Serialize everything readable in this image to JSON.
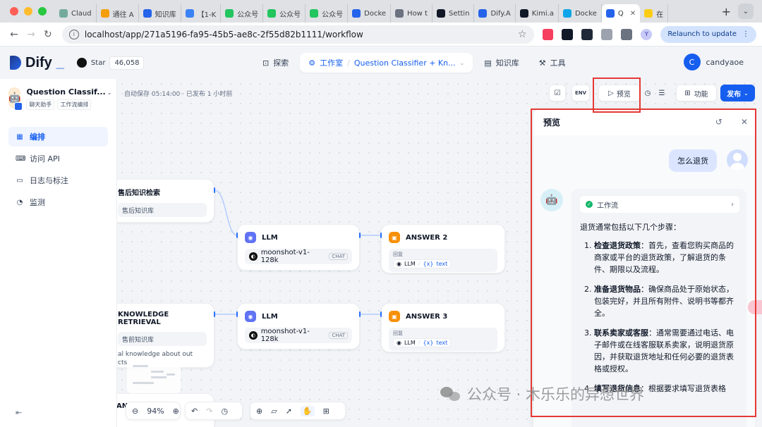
{
  "browser": {
    "tabs": [
      {
        "label": "Claud",
        "color": "#74aa9c"
      },
      {
        "label": "通往 A",
        "color": "#f59e0b"
      },
      {
        "label": "知识库",
        "color": "#2563eb"
      },
      {
        "label": "【1-K",
        "color": "#3b82f6"
      },
      {
        "label": "公众号",
        "color": "#22c55e"
      },
      {
        "label": "公众号",
        "color": "#22c55e"
      },
      {
        "label": "公众号",
        "color": "#22c55e"
      },
      {
        "label": "Docke",
        "color": "#2563eb"
      },
      {
        "label": "How t",
        "color": "#6b7280"
      },
      {
        "label": "Settin",
        "color": "#111827"
      },
      {
        "label": "Dify.A",
        "color": "#2563eb"
      },
      {
        "label": "Kimi.a",
        "color": "#111827"
      },
      {
        "label": "Docke",
        "color": "#0ea5e9"
      },
      {
        "label": "Q",
        "color": "#2563eb",
        "active": true
      },
      {
        "label": "在",
        "color": "#facc15"
      }
    ],
    "url": "localhost/app/271a5196-fa95-45b5-ae8c-2f55d82b1111/workflow",
    "profile_initial": "Y",
    "relaunch_label": "Relaunch to update"
  },
  "header": {
    "brand": "Dify",
    "github_label": "Star",
    "github_count": "46,058",
    "nav": {
      "explore": "探索",
      "studio": "工作室",
      "app_name": "Question Classifier + Kn...",
      "knowledge": "知识库",
      "tools": "工具"
    },
    "user": {
      "initial": "C",
      "name": "candyaoe"
    }
  },
  "sidebar": {
    "app_name": "Question Classif...",
    "tags": [
      "聊天助手",
      "工作流编排"
    ],
    "items": [
      {
        "label": "编排",
        "icon": "layout-icon",
        "active": true
      },
      {
        "label": "访问 API",
        "icon": "terminal-icon"
      },
      {
        "label": "日志与标注",
        "icon": "file-text-icon"
      },
      {
        "label": "监测",
        "icon": "monitor-icon"
      }
    ]
  },
  "canvas": {
    "autosave": "自动保存 05:14:00 · 已发布 1 小时前",
    "toolbar": {
      "preview": "预览",
      "features": "功能",
      "publish": "发布",
      "env": "ENV"
    },
    "nodes": {
      "kr1": {
        "title": "售后知识检索",
        "kb": "售后知识库"
      },
      "kr2": {
        "title": "KNOWLEDGE RETRIEVAL",
        "kb": "售前知识库",
        "desc": "al knowledge about out",
        "desc2": "cts."
      },
      "kr3": {
        "title": "ANS"
      },
      "llm1": {
        "title": "LLM",
        "model": "moonshot-v1-128k",
        "tag": "CHAT"
      },
      "llm2": {
        "title": "LLM",
        "model": "moonshot-v1-128k",
        "tag": "CHAT"
      },
      "ans2": {
        "title": "ANSWER 2",
        "reply_label": "回复",
        "var_node": "LLM",
        "var_name": "text"
      },
      "ans3": {
        "title": "ANSWER 3",
        "reply_label": "回复",
        "var_node": "LLM",
        "var_name": "text"
      }
    },
    "zoom": "94%"
  },
  "preview": {
    "title": "预览",
    "question": "怎么退货",
    "workflow_label": "工作流",
    "intro": "退货通常包括以下几个步骤：",
    "steps": [
      {
        "title": "检查退货政策",
        "body": "：首先，查看您购买商品的商家或平台的退货政策，了解退货的条件、期限以及流程。"
      },
      {
        "title": "准备退货物品",
        "body": "：确保商品处于原始状态，包装完好，并且所有附件、说明书等都齐全。"
      },
      {
        "title": "联系卖家或客服",
        "body": "：通常需要通过电话、电子邮件或在线客服联系卖家，说明退货原因，并获取退货地址和任何必要的退货表格或授权。"
      },
      {
        "title": "填写退货信息",
        "body": "：根据要求填写退货表格"
      }
    ]
  },
  "watermark": "公众号 · 木乐乐的异想世界"
}
